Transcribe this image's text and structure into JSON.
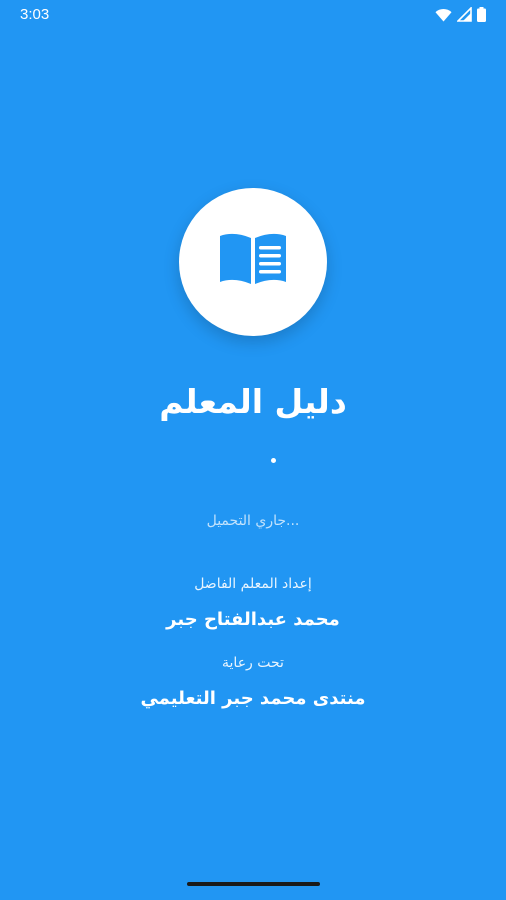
{
  "status_bar": {
    "time": "3:03",
    "icons": [
      "wifi-icon",
      "signal-icon",
      "battery-icon"
    ]
  },
  "logo": {
    "icon": "open-book-icon",
    "icon_color": "#2196F3"
  },
  "app": {
    "title": "دليل المعلم"
  },
  "loading": {
    "text": "...جاري التحميل"
  },
  "credits": {
    "prepared_label": "إعداد المعلم الفاضل",
    "author_name": "محمد عبدالفتاح جبر",
    "sponsor_label": "تحت رعاية",
    "sponsor_name": "منتدى محمد جبر التعليمي"
  },
  "colors": {
    "background": "#2196F3",
    "text": "#FFFFFF"
  }
}
